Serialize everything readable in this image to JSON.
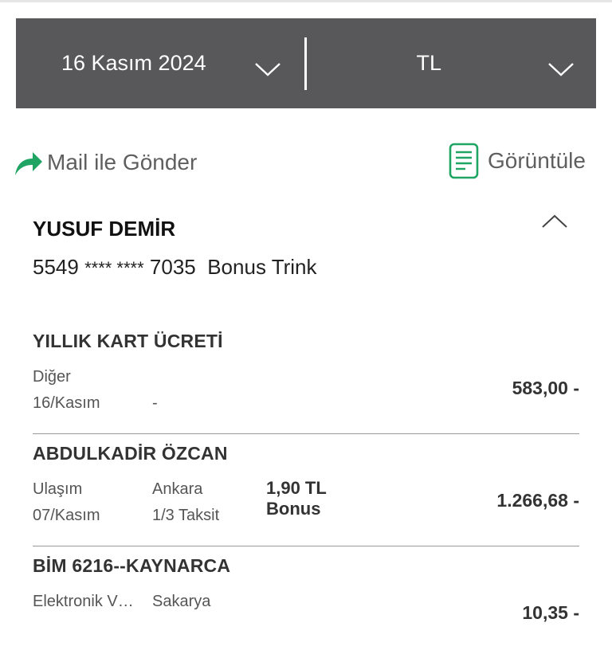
{
  "filters": {
    "date": "16 Kasım 2024",
    "currency": "TL"
  },
  "actions": {
    "mail": "Mail ile Gönder",
    "view": "Görüntüle"
  },
  "colors": {
    "accent_green": "#1fa463",
    "bar_bg": "#58575a"
  },
  "card": {
    "owner": "YUSUF DEMİR",
    "number_first": "5549",
    "number_masked": "**** ****",
    "number_last": "7035",
    "product": "Bonus Trink"
  },
  "transactions": [
    {
      "merchant": "YILLIK KART ÜCRETİ",
      "category": "Diğer",
      "location": "",
      "date": "16/Kasım",
      "installment": "-",
      "bonus_amount": "",
      "bonus_label": "",
      "amount": "583,00 -"
    },
    {
      "merchant": "ABDULKADİR ÖZCAN",
      "category": "Ulaşım",
      "location": "Ankara",
      "date": "07/Kasım",
      "installment": "1/3 Taksit",
      "bonus_amount": "1,90 TL",
      "bonus_label": "Bonus",
      "amount": "1.266,68 -"
    },
    {
      "merchant": "BİM 6216--KAYNARCA",
      "category": "Elektronik V…",
      "location": "Sakarya",
      "date": "",
      "installment": "",
      "bonus_amount": "",
      "bonus_label": "",
      "amount": "10,35 -"
    }
  ]
}
